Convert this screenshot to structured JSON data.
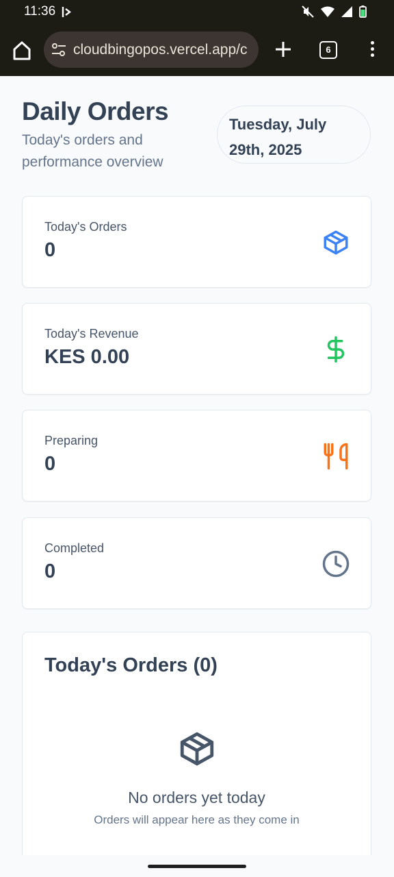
{
  "status_bar": {
    "time": "11:36"
  },
  "browser": {
    "url": "cloudbingopos.vercel.app/c",
    "tab_count": "6"
  },
  "header": {
    "title": "Daily Orders",
    "subtitle": "Today's orders and performance overview",
    "date": "Tuesday, July 29th, 2025"
  },
  "stats": [
    {
      "label": "Today's Orders",
      "value": "0",
      "icon": "package-icon",
      "color": "#3b82f6"
    },
    {
      "label": "Today's Revenue",
      "value": "KES 0.00",
      "icon": "dollar-sign-icon",
      "color": "#22c55e"
    },
    {
      "label": "Preparing",
      "value": "0",
      "icon": "utensils-icon",
      "color": "#f97316"
    },
    {
      "label": "Completed",
      "value": "0",
      "icon": "clock-icon",
      "color": "#64748b"
    }
  ],
  "orders": {
    "title": "Today's Orders (0)",
    "empty_title": "No orders yet today",
    "empty_subtitle": "Orders will appear here as they come in",
    "empty_icon_color": "#475569"
  }
}
